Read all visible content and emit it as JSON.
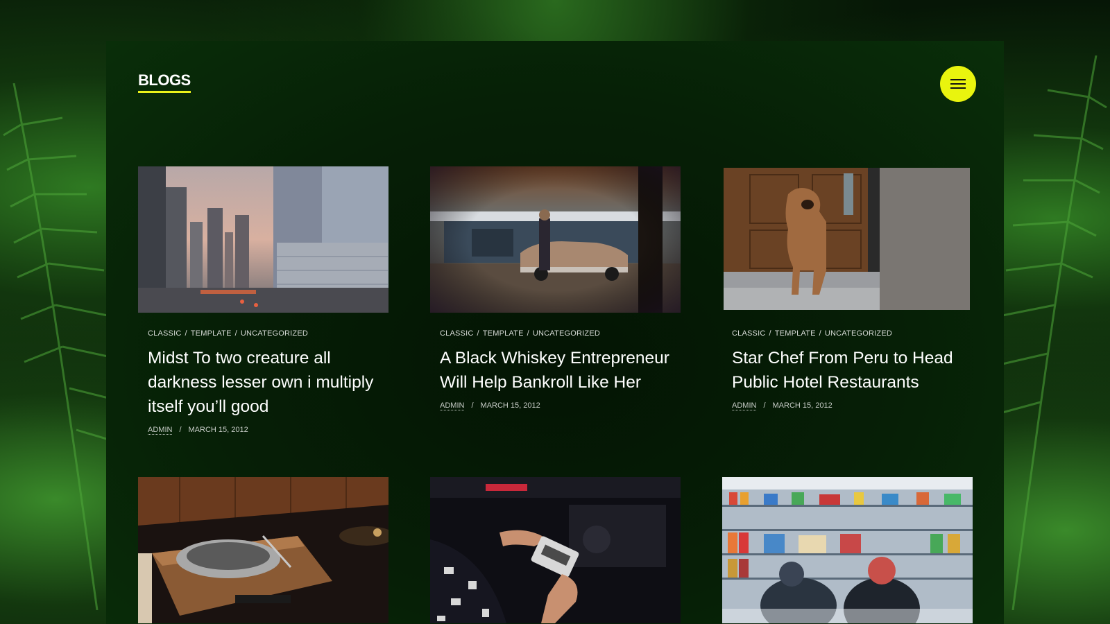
{
  "header": {
    "title": "BLOGS",
    "menu_icon": "hamburger-icon"
  },
  "colors": {
    "accent": "#e9f40e",
    "background": "#061606",
    "panel": "#051705",
    "text": "#ffffff"
  },
  "posts": [
    {
      "categories": [
        "CLASSIC",
        "TEMPLATE",
        "UNCATEGORIZED"
      ],
      "title": "Midst To two creature all darkness lesser own i multiply itself you’ll good",
      "author": "ADMIN",
      "date": "MARCH 15, 2012",
      "image": "city-skyline-image"
    },
    {
      "categories": [
        "CLASSIC",
        "TEMPLATE",
        "UNCATEGORIZED"
      ],
      "title": "A Black Whiskey Entrepreneur Will Help Bankroll Like Her",
      "author": "ADMIN",
      "date": "MARCH 15, 2012",
      "image": "vintage-car-image"
    },
    {
      "categories": [
        "CLASSIC",
        "TEMPLATE",
        "UNCATEGORIZED"
      ],
      "title": "Star Chef From Peru to Head Public Hotel Restaurants",
      "author": "ADMIN",
      "date": "MARCH 15, 2012",
      "image": "dog-at-door-image"
    },
    {
      "image": "record-player-image"
    },
    {
      "image": "cassette-in-car-image"
    },
    {
      "image": "store-shelves-image"
    }
  ],
  "separators": {
    "category": "/",
    "meta": "/"
  }
}
